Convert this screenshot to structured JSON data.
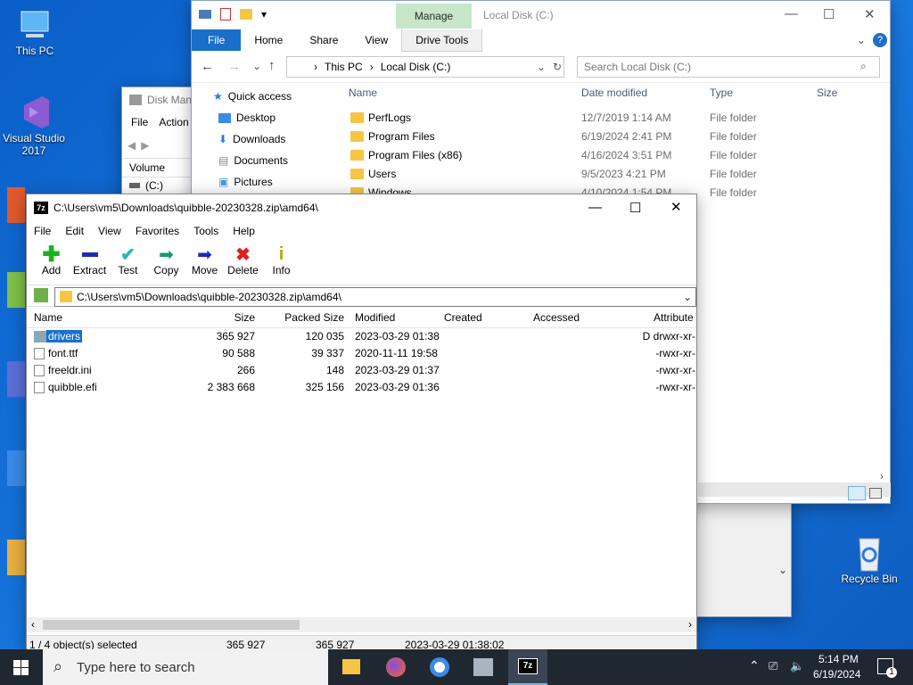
{
  "desktop": {
    "icons": [
      {
        "label": "This PC"
      },
      {
        "label": "Visual Studio 2017"
      },
      {
        "label": "Recycle Bin"
      }
    ]
  },
  "explorer": {
    "ribbon_context": "Manage",
    "window_title": "Local Disk (C:)",
    "tabs": [
      "File",
      "Home",
      "Share",
      "View",
      "Drive Tools"
    ],
    "breadcrumb": [
      "This PC",
      "Local Disk (C:)"
    ],
    "search_placeholder": "Search Local Disk (C:)",
    "nav": [
      "Quick access",
      "Desktop",
      "Downloads",
      "Documents",
      "Pictures"
    ],
    "columns": [
      "Name",
      "Date modified",
      "Type",
      "Size"
    ],
    "rows": [
      {
        "name": "PerfLogs",
        "date": "12/7/2019 1:14 AM",
        "type": "File folder"
      },
      {
        "name": "Program Files",
        "date": "6/19/2024 2:41 PM",
        "type": "File folder"
      },
      {
        "name": "Program Files (x86)",
        "date": "4/16/2024 3:51 PM",
        "type": "File folder"
      },
      {
        "name": "Users",
        "date": "9/5/2023 4:21 PM",
        "type": "File folder"
      },
      {
        "name": "Windows",
        "date": "4/10/2024 1:54 PM",
        "type": "File folder"
      }
    ]
  },
  "diskmgmt": {
    "title": "Disk Man",
    "menu": [
      "File",
      "Action"
    ],
    "col_volume": "Volume",
    "volume_c": "(C:)"
  },
  "sevenzip": {
    "title": "C:\\Users\\vm5\\Downloads\\quibble-20230328.zip\\amd64\\",
    "menu": [
      "File",
      "Edit",
      "View",
      "Favorites",
      "Tools",
      "Help"
    ],
    "tools": [
      "Add",
      "Extract",
      "Test",
      "Copy",
      "Move",
      "Delete",
      "Info"
    ],
    "path": "C:\\Users\\vm5\\Downloads\\quibble-20230328.zip\\amd64\\",
    "columns": [
      "Name",
      "Size",
      "Packed Size",
      "Modified",
      "Created",
      "Accessed",
      "Attribute"
    ],
    "rows": [
      {
        "name": "drivers",
        "size": "365 927",
        "packed": "120 035",
        "modified": "2023-03-29 01:38",
        "attr": "D drwxr-xr-"
      },
      {
        "name": "font.ttf",
        "size": "90 588",
        "packed": "39 337",
        "modified": "2020-11-11 19:58",
        "attr": "-rwxr-xr-"
      },
      {
        "name": "freeldr.ini",
        "size": "266",
        "packed": "148",
        "modified": "2023-03-29 01:37",
        "attr": "-rwxr-xr-"
      },
      {
        "name": "quibble.efi",
        "size": "2 383 668",
        "packed": "325 156",
        "modified": "2023-03-29 01:36",
        "attr": "-rwxr-xr-"
      }
    ],
    "status": {
      "selected": "1 / 4 object(s) selected",
      "size": "365 927",
      "packed": "365 927",
      "modified": "2023-03-29 01:38:02"
    }
  },
  "taskbar": {
    "search_placeholder": "Type here to search",
    "time": "5:14 PM",
    "date": "6/19/2024",
    "notifications": "1"
  }
}
